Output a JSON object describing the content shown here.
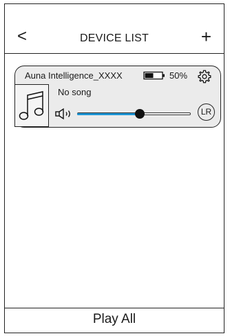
{
  "header": {
    "back_label": "<",
    "title": "DEVICE LIST",
    "add_label": "+"
  },
  "device": {
    "name": "Auna Intelligence_XXXX",
    "battery_percent_text": "50%",
    "battery_level": 0.5,
    "song": "No song",
    "volume_level": 0.55,
    "channel_label": "LR",
    "icons": {
      "battery": "battery-icon",
      "settings": "gear-icon",
      "album": "music-note-icon",
      "speaker": "speaker-icon"
    }
  },
  "footer": {
    "play_all_label": "Play All"
  },
  "colors": {
    "card_background": "#ebebeb",
    "slider_fill": "#1c93d3",
    "border": "#222222"
  }
}
